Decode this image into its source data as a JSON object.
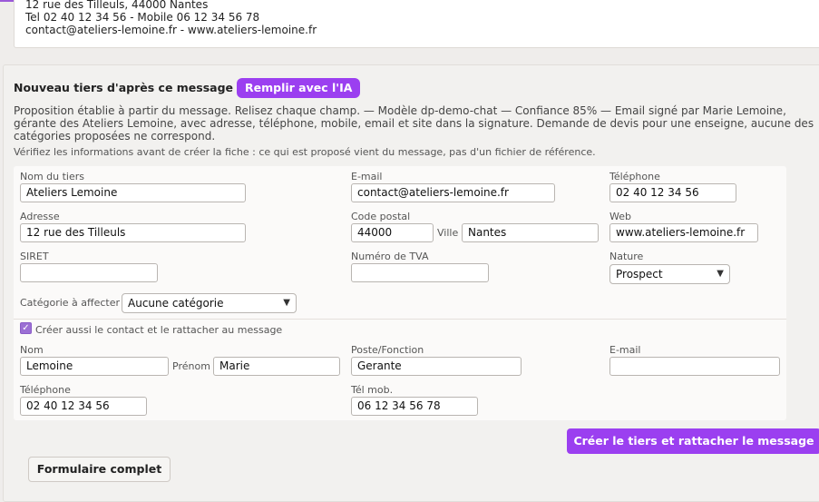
{
  "signature": {
    "line1": "12 rue des Tilleuls, 44000 Nantes",
    "line2": "Tel 02 40 12 34 56 - Mobile 06 12 34 56 78",
    "line3": "contact@ateliers-lemoine.fr - www.ateliers-lemoine.fr"
  },
  "section": {
    "title": "Nouveau tiers d'après ce message",
    "ia_button": "Remplir avec l'IA",
    "description_lines": [
      "Proposition établie à partir du message. Relisez chaque champ. — Modèle dp-demo-chat — Confiance 85% — Email signé par Marie Lemoine,",
      "gérante des Ateliers Lemoine, avec adresse, téléphone, mobile, email et site dans la signature. Demande de devis pour une enseigne, aucune des",
      "catégories proposées ne correspond."
    ],
    "note": "Vérifiez les informations avant de créer la fiche : ce qui est proposé vient du message, pas d'un fichier de référence."
  },
  "tiers": {
    "name_label": "Nom du tiers",
    "name": "Ateliers Lemoine",
    "email_label": "E-mail",
    "email": "contact@ateliers-lemoine.fr",
    "phone_label": "Téléphone",
    "phone": "02 40 12 34 56",
    "address_label": "Adresse",
    "address": "12 rue des Tilleuls",
    "zip_label": "Code postal",
    "zip": "44000",
    "city_label": "Ville",
    "city": "Nantes",
    "web_label": "Web",
    "web": "www.ateliers-lemoine.fr",
    "siret_label": "SIRET",
    "siret": "",
    "tva_label": "Numéro de TVA",
    "tva": "",
    "nature_label": "Nature",
    "nature": "Prospect",
    "category_label": "Catégorie à affecter",
    "category": "Aucune catégorie"
  },
  "contact": {
    "checkbox_label": "Créer aussi le contact et le rattacher au message",
    "checked": true,
    "lastname_label": "Nom",
    "lastname": "Lemoine",
    "firstname_label": "Prénom",
    "firstname": "Marie",
    "position_label": "Poste/Fonction",
    "position": "Gerante",
    "email_label": "E-mail",
    "email": "",
    "phone_label": "Téléphone",
    "phone": "02 40 12 34 56",
    "mobile_label": "Tél mob.",
    "mobile": "06 12 34 56 78"
  },
  "actions": {
    "create": "Créer le tiers et rattacher le message",
    "full_form": "Formulaire complet"
  },
  "colors": {
    "accent": "#9b3ff0",
    "topbar": "#9b59d8"
  }
}
